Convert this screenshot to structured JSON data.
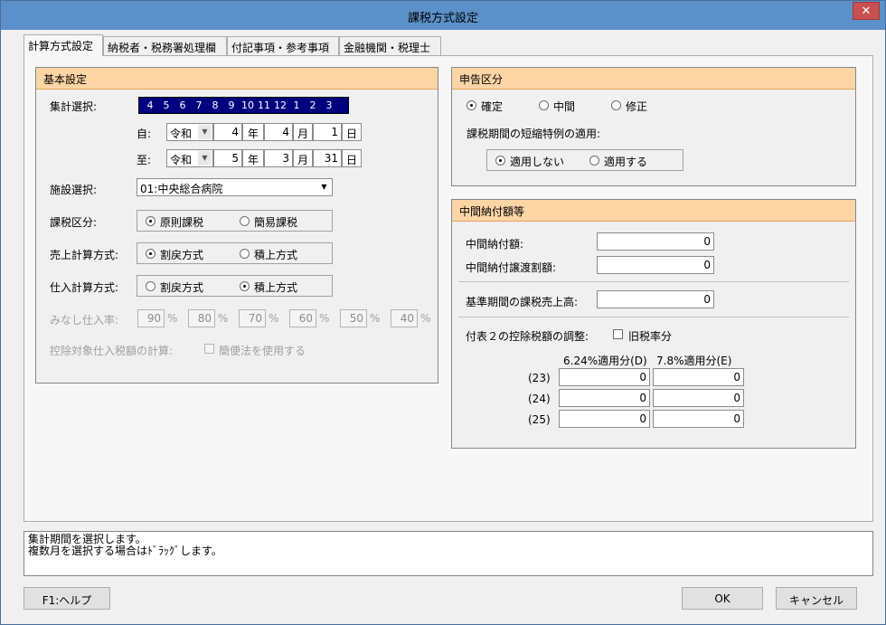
{
  "window": {
    "title": "課税方式設定",
    "close_glyph": "✕"
  },
  "tabs": [
    "計算方式設定",
    "納税者・税務署処理欄",
    "付記事項・参考事項",
    "金融機関・税理士"
  ],
  "basic": {
    "header": "基本設定",
    "aggregate_label": "集計選択:",
    "months": [
      "4",
      "5",
      "6",
      "7",
      "8",
      "9",
      "10",
      "11",
      "12",
      "1",
      "2",
      "3"
    ],
    "from_label": "自:",
    "to_label": "至:",
    "from": {
      "era": "令和",
      "year": "4",
      "year_unit": "年",
      "month": "4",
      "month_unit": "月",
      "day": "1",
      "day_unit": "日"
    },
    "to": {
      "era": "令和",
      "year": "5",
      "year_unit": "年",
      "month": "3",
      "month_unit": "月",
      "day": "31",
      "day_unit": "日"
    },
    "facility_label": "施設選択:",
    "facility_value": "01:中央総合病院",
    "tax_class_label": "課税区分:",
    "tax_class_options": [
      "原則課税",
      "簡易課税"
    ],
    "sales_calc_label": "売上計算方式:",
    "sales_calc_options": [
      "割戻方式",
      "積上方式"
    ],
    "purchase_calc_label": "仕入計算方式:",
    "purchase_calc_options": [
      "割戻方式",
      "積上方式"
    ],
    "deemed_label": "みなし仕入率:",
    "deemed_rates": [
      "90",
      "80",
      "70",
      "60",
      "50",
      "40"
    ],
    "percent": "%",
    "deduct_label": "控除対象仕入税額の計算:",
    "deduct_check_label": "簡便法を使用する"
  },
  "declaration": {
    "header": "申告区分",
    "options": [
      "確定",
      "中間",
      "修正"
    ],
    "shorten_label": "課税期間の短縮特例の適用:",
    "shorten_options": [
      "適用しない",
      "適用する"
    ]
  },
  "interim": {
    "header": "中間納付額等",
    "interim_label": "中間納付額:",
    "interim_value": "0",
    "transfer_label": "中間納付譲渡割額:",
    "transfer_value": "0",
    "base_sales_label": "基準期間の課税売上高:",
    "base_sales_value": "0",
    "adjust_label": "付表２の控除税額の調整:",
    "old_rate_label": "旧税率分",
    "col_d": "6.24%適用分(D)",
    "col_e": "7.8%適用分(E)",
    "rows": [
      {
        "label": "(23)",
        "d": "0",
        "e": "0"
      },
      {
        "label": "(24)",
        "d": "0",
        "e": "0"
      },
      {
        "label": "(25)",
        "d": "0",
        "e": "0"
      }
    ]
  },
  "status_lines": [
    "集計期間を選択します。",
    "複数月を選択する場合はﾄﾞﾗｯｸﾞします。"
  ],
  "buttons": {
    "help": "F1:ヘルプ",
    "ok": "OK",
    "cancel": "キャンセル"
  }
}
